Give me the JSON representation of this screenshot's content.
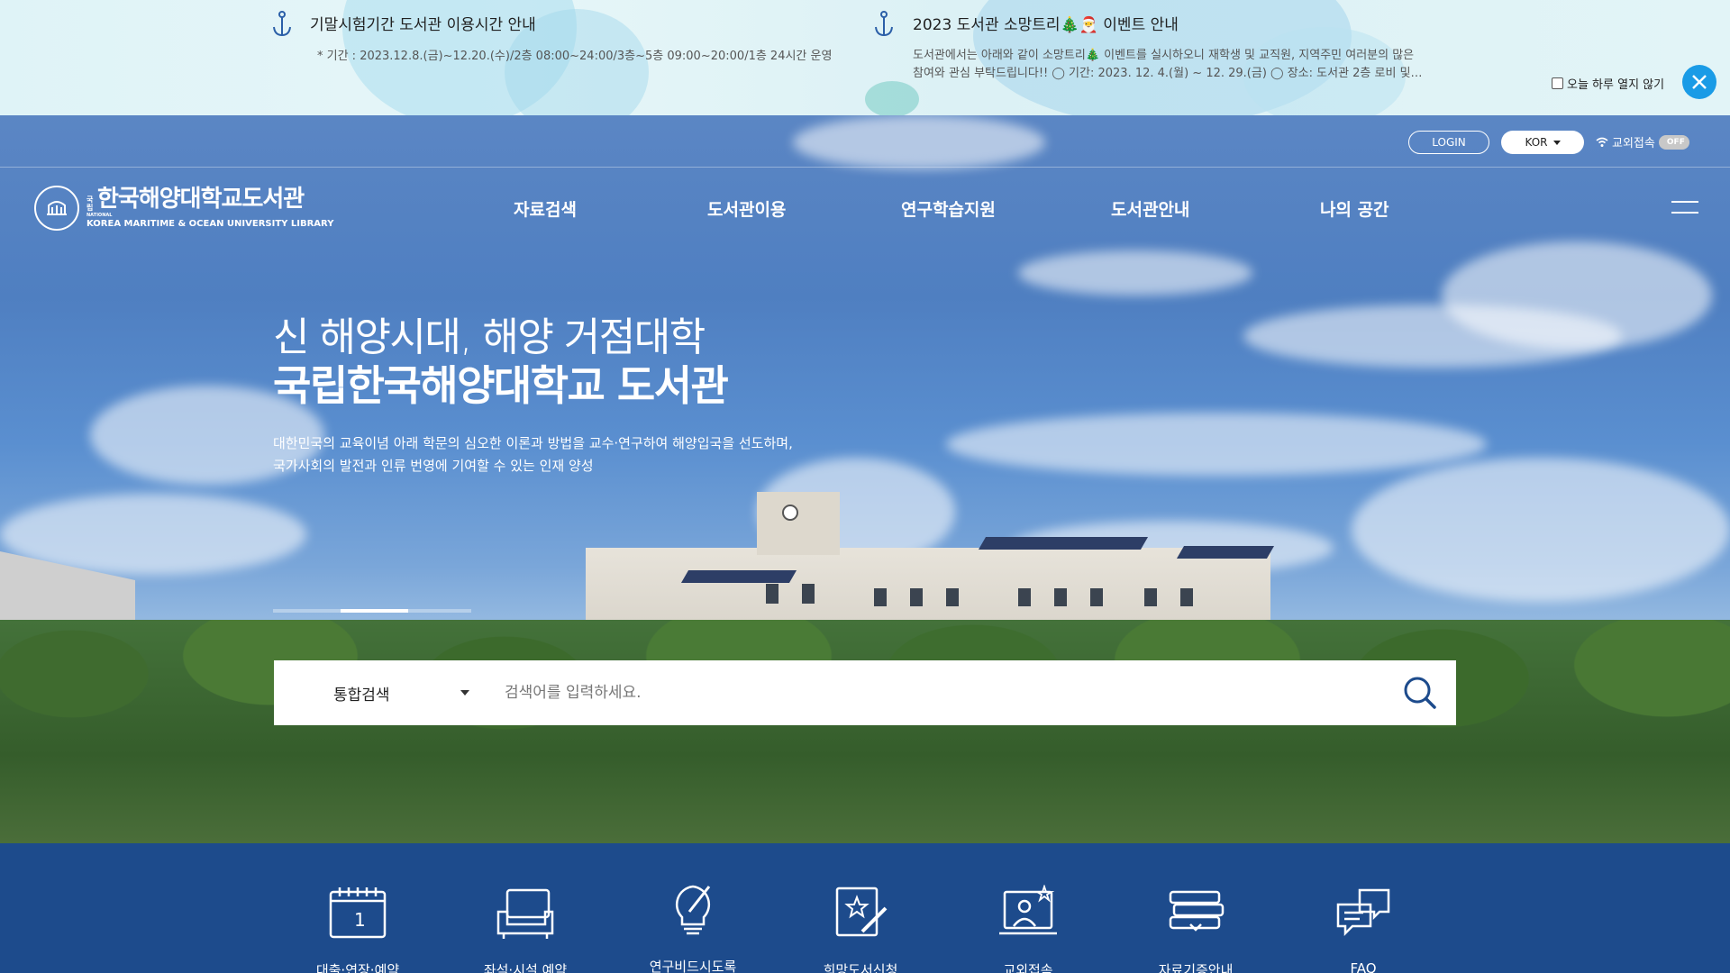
{
  "notices": [
    {
      "title": "기말시험기간 도서관 이용시간 안내",
      "desc_lines": [
        "* 기간 : 2023.12.8.(금)~12.20.(수)/2층 08:00~24:00/3층~5층 09:00~20:00/1층 24시간 운영"
      ]
    },
    {
      "title": "2023 도서관 소망트리🎄🎅 이벤트 안내",
      "desc_lines": [
        "도서관에서는 아래와 같이 소망트리🎄 이벤트를 실시하오니 재학생 및 교직원, 지역주민 여러분의 많은",
        "참여와 관심 부탁드립니다!! ◯ 기간: 2023. 12. 4.(월) ~ 12. 29.(금) ◯ 장소: 도서관 2층 로비 및…"
      ]
    }
  ],
  "popup": {
    "close_today_label": "오늘 하루 열지 않기"
  },
  "util": {
    "login_label": "LOGIN",
    "lang_label": "KOR",
    "remote_label": "교외접속",
    "remote_toggle": "OFF"
  },
  "logo": {
    "national": "국립",
    "name_ko": "한국해양대학교도서관",
    "name_en": "KOREA MARITIME & OCEAN UNIVERSITY LIBRARY",
    "national_en": "NATIONAL"
  },
  "nav": [
    "자료검색",
    "도서관이용",
    "연구학습지원",
    "도서관안내",
    "나의 공간"
  ],
  "hero": {
    "subtitle": "신 해양시대, 해양 거점대학",
    "title": "국립한국해양대학교 도서관",
    "desc_line1": "대한민국의 교육이념 아래 학문의 심오한 이론과 방법을 교수·연구하여 해양입국을 선도하며,",
    "desc_line2": "국가사회의 발전과 인류 번영에 기여할 수 있는 인재 양성"
  },
  "search": {
    "scope": "통합검색",
    "placeholder": "검색어를 입력하세요."
  },
  "quick_menu": [
    {
      "label": "대출·연장·예약",
      "icon": "calendar-icon"
    },
    {
      "label": "좌석·시설 예약",
      "icon": "sofa-icon"
    },
    {
      "label": "연구비드시도록",
      "icon": "lightbulb-pen-icon"
    },
    {
      "label": "희망도서신청",
      "icon": "book-star-icon"
    },
    {
      "label": "교외접속",
      "icon": "monitor-user-icon"
    },
    {
      "label": "자료기증안내",
      "icon": "books-icon"
    },
    {
      "label": "FAQ",
      "icon": "chat-bubbles-icon"
    }
  ],
  "colors": {
    "accent": "#1a9be6",
    "brand_navy": "#1d4b8c"
  }
}
